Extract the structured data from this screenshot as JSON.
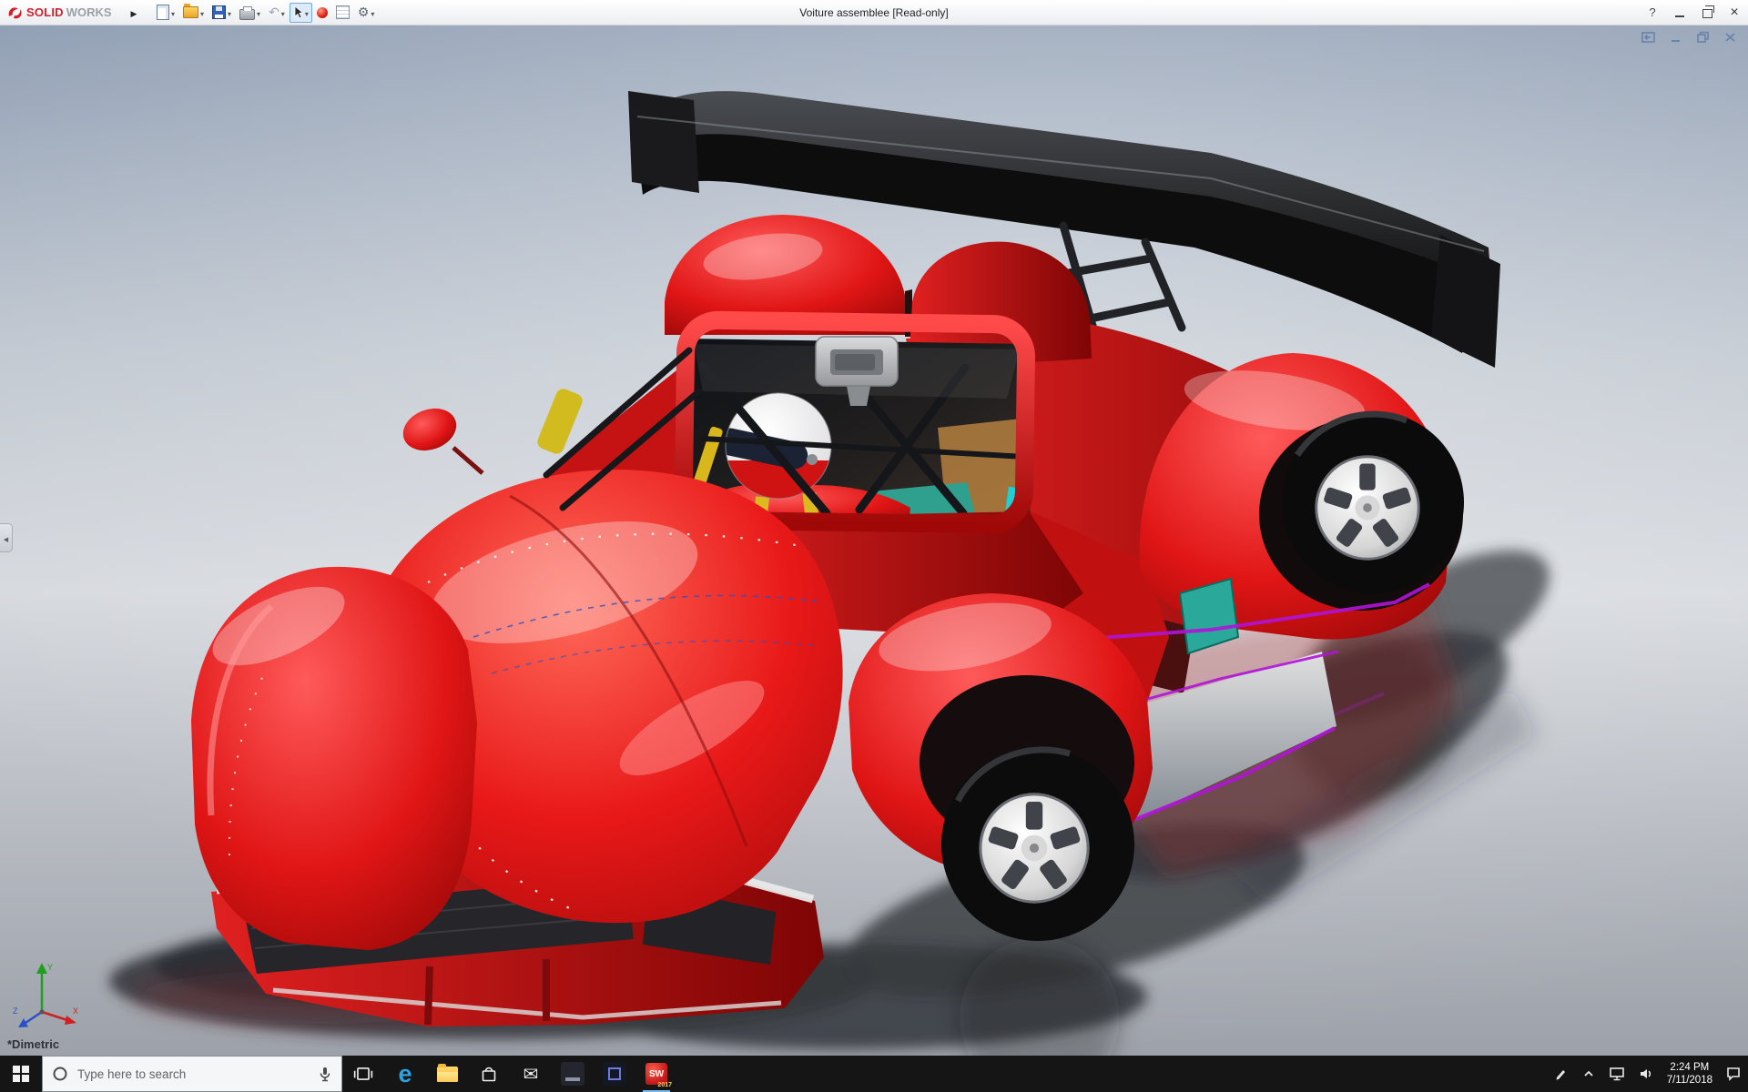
{
  "titlebar": {
    "brand_solid": "SOLID",
    "brand_works": "WORKS",
    "title": "Voiture assemblee [Read-only]",
    "controls": {
      "help": "?"
    },
    "toolbar_icons": [
      "new-document",
      "open",
      "save",
      "print",
      "undo",
      "select-cursor",
      "appearance-sphere",
      "sheet-format",
      "options-gear"
    ]
  },
  "viewport": {
    "view_label": "*Dimetric",
    "triad": {
      "x": "X",
      "y": "Y",
      "z": "Z"
    },
    "doc_controls": [
      "reattach-pane",
      "minimize-document",
      "restore-document",
      "close-document"
    ]
  },
  "model": {
    "colors": {
      "body_red": "#d01616",
      "wing_black": "#141414",
      "accent_teal": "#2aa89a",
      "accent_purple": "#b014d8",
      "rim_silver": "#d6d6d6"
    }
  },
  "taskbar": {
    "search_placeholder": "Type here to search",
    "edge_letter": "e",
    "solidworks_label": "SW",
    "solidworks_version": "2017",
    "time": "2:24 PM",
    "date": "7/11/2018",
    "apps": [
      "start",
      "search",
      "task-view",
      "edge",
      "file-explorer",
      "store",
      "mail",
      "dark-app-1",
      "dark-app-2",
      "solidworks"
    ],
    "tray_icons": [
      "pen",
      "hidden-icons-chevron",
      "network",
      "volume",
      "clock",
      "action-center"
    ]
  }
}
